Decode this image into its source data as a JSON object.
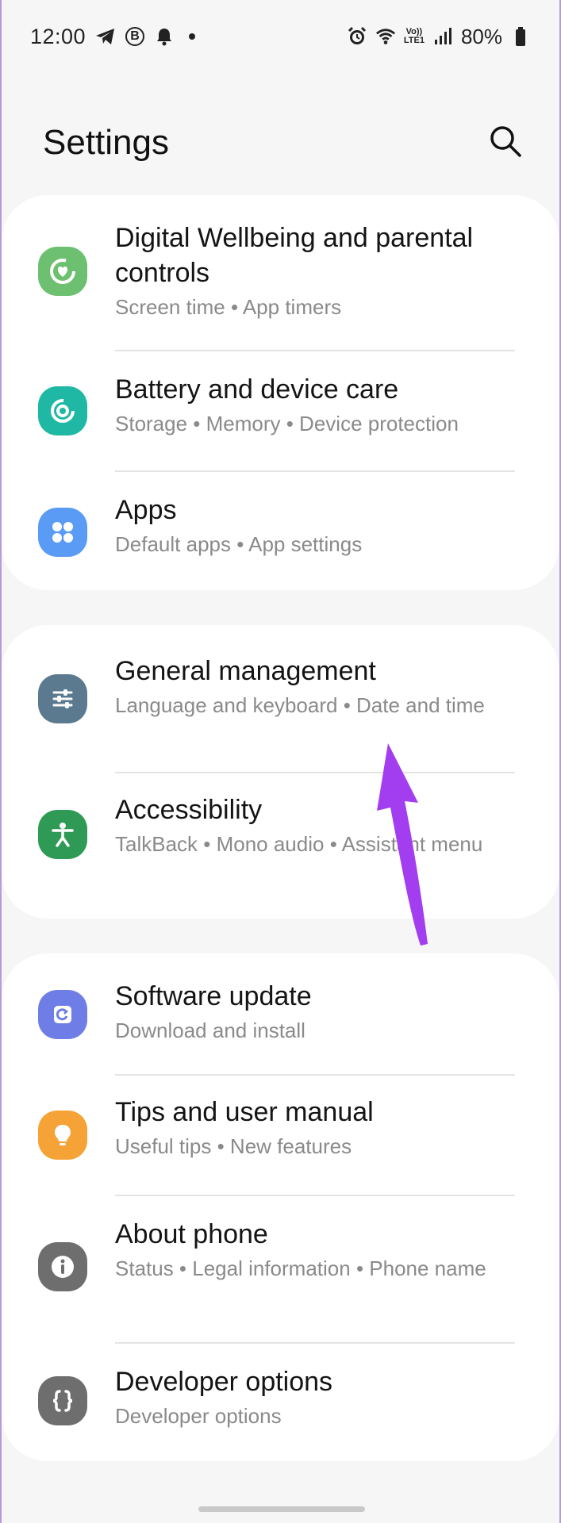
{
  "status_bar": {
    "time": "12:00",
    "volte_top": "Vo))",
    "volte_bottom": "LTE1",
    "battery": "80%"
  },
  "header": {
    "title": "Settings"
  },
  "groups": [
    {
      "items": [
        {
          "title": "Digital Wellbeing and parental controls",
          "subtitle": "Screen time  •  App timers",
          "icon": "digital-wellbeing-icon",
          "color": "#6cc070"
        },
        {
          "title": "Battery and device care",
          "subtitle": "Storage  •  Memory  •  Device protection",
          "icon": "device-care-icon",
          "color": "#1fb8a4"
        },
        {
          "title": "Apps",
          "subtitle": "Default apps  •  App settings",
          "icon": "apps-icon",
          "color": "#5a9cf5"
        }
      ]
    },
    {
      "items": [
        {
          "title": "General management",
          "subtitle": "Language and keyboard  •  Date and time",
          "icon": "general-management-icon",
          "color": "#5b7a90"
        },
        {
          "title": "Accessibility",
          "subtitle": "TalkBack  •  Mono audio  •  Assistant menu",
          "icon": "accessibility-icon",
          "color": "#2f9a56"
        }
      ]
    },
    {
      "items": [
        {
          "title": "Software update",
          "subtitle": "Download and install",
          "icon": "software-update-icon",
          "color": "#6f7ee6"
        },
        {
          "title": "Tips and user manual",
          "subtitle": "Useful tips  •  New features",
          "icon": "tips-icon",
          "color": "#f5a336"
        },
        {
          "title": "About phone",
          "subtitle": "Status  •  Legal information  •  Phone name",
          "icon": "about-phone-icon",
          "color": "#6e6e6e"
        },
        {
          "title": "Developer options",
          "subtitle": "Developer options",
          "icon": "developer-options-icon",
          "color": "#6e6e6e"
        }
      ]
    }
  ],
  "annotation": {
    "arrow_color": "#a23ef0"
  }
}
